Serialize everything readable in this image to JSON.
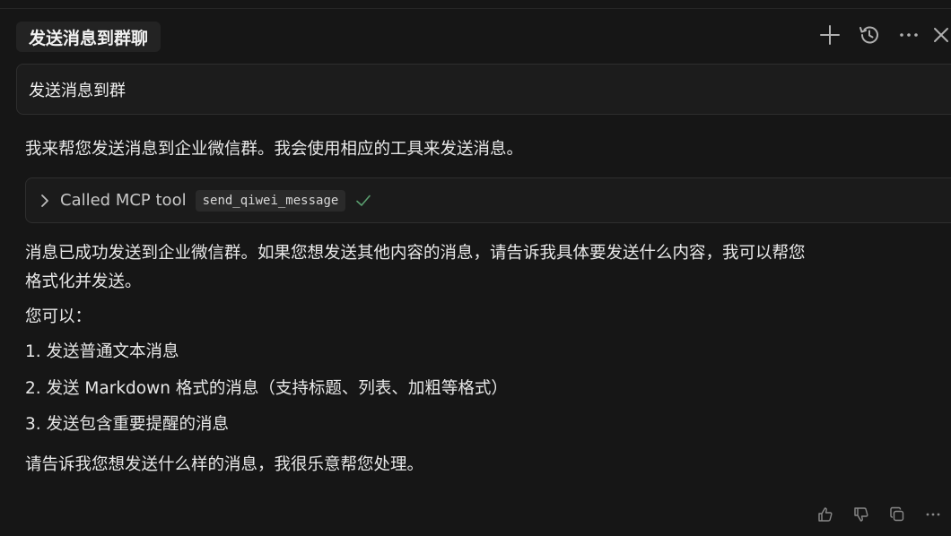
{
  "header": {
    "title": "发送消息到群聊",
    "actions": [
      {
        "icon": "plus-icon",
        "name": "new-chat-button"
      },
      {
        "icon": "history-icon",
        "name": "history-button"
      },
      {
        "icon": "more-icon",
        "name": "more-button"
      },
      {
        "icon": "close-icon",
        "name": "close-button"
      }
    ]
  },
  "user_message": {
    "text": "发送消息到群"
  },
  "assistant": {
    "intro": "我来帮您发送消息到企业微信群。我会使用相应的工具来发送消息。",
    "tool_call": {
      "label": "Called MCP tool",
      "tool_name": "send_qiwei_message",
      "status_icon": "check-icon",
      "status_color": "#5a9e6f"
    },
    "result_line1": "消息已成功发送到企业微信群。如果您想发送其他内容的消息，请告诉我具体要发送什么内容，我可以帮您",
    "result_line2": "格式化并发送。",
    "options_intro": "您可以：",
    "options": [
      "1. 发送普通文本消息",
      "2. 发送 Markdown 格式的消息（支持标题、列表、加粗等格式）",
      "3. 发送包含重要提醒的消息"
    ],
    "closing": "请告诉我您想发送什么样的消息，我很乐意帮您处理。"
  },
  "footer": {
    "actions": [
      "thumbs-up-icon",
      "thumbs-down-icon",
      "copy-icon",
      "more-icon"
    ]
  }
}
